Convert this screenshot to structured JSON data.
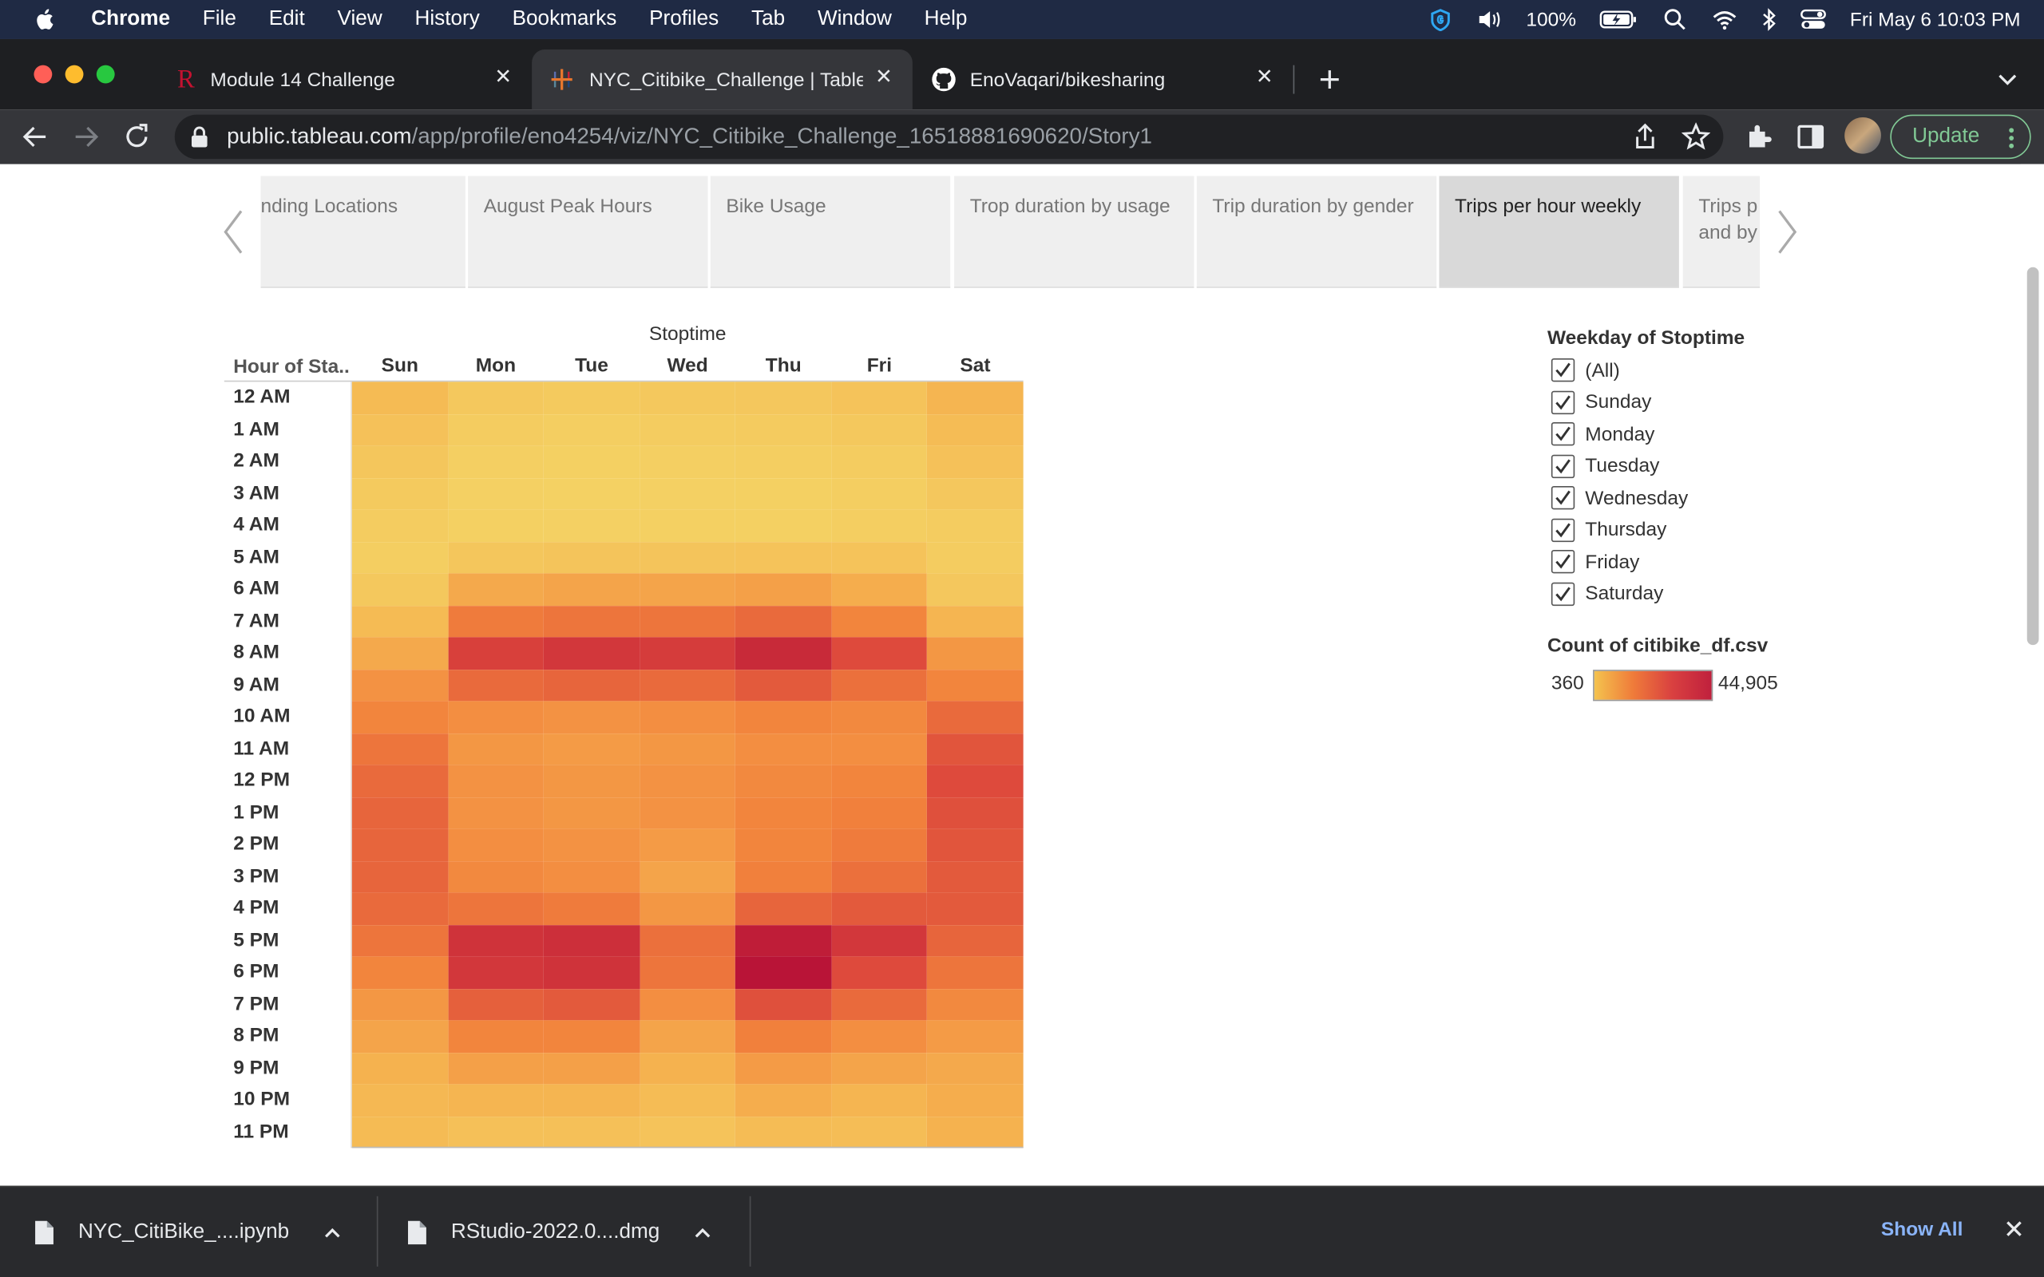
{
  "menubar": {
    "items": [
      "Chrome",
      "File",
      "Edit",
      "View",
      "History",
      "Bookmarks",
      "Profiles",
      "Tab",
      "Window",
      "Help"
    ],
    "battery": "100%",
    "clock": "Fri May 6  10:03 PM"
  },
  "tabs": [
    {
      "title": "Module 14 Challenge",
      "favicon": "r-logo-icon"
    },
    {
      "title": "NYC_Citibike_Challenge | Table",
      "favicon": "tableau-icon",
      "active": true
    },
    {
      "title": "EnoVaqari/bikesharing",
      "favicon": "github-icon"
    }
  ],
  "address": {
    "host": "public.tableau.com",
    "path": "/app/profile/eno4254/viz/NYC_Citibike_Challenge_16518881690620/Story1"
  },
  "update_label": "Update",
  "story_points": [
    {
      "label": "nding Locations"
    },
    {
      "label": "August Peak Hours"
    },
    {
      "label": "Bike Usage"
    },
    {
      "label": "Trop duration by usage"
    },
    {
      "label": "Trip duration by gender"
    },
    {
      "label": "Trips per hour weekly",
      "active": true
    },
    {
      "label": "Trips p and by"
    }
  ],
  "chart_data": {
    "type": "heatmap",
    "title": "Stoptime",
    "row_header": "Hour of Sta..",
    "columns": [
      "Sun",
      "Mon",
      "Tue",
      "Wed",
      "Thu",
      "Fri",
      "Sat"
    ],
    "rows": [
      "12 AM",
      "1 AM",
      "2 AM",
      "3 AM",
      "4 AM",
      "5 AM",
      "6 AM",
      "7 AM",
      "8 AM",
      "9 AM",
      "10 AM",
      "11 AM",
      "12 PM",
      "1 PM",
      "2 PM",
      "3 PM",
      "4 PM",
      "5 PM",
      "6 PM",
      "7 PM",
      "8 PM",
      "9 PM",
      "10 PM",
      "11 PM"
    ],
    "values": [
      [
        9000,
        4000,
        3500,
        4000,
        4500,
        6000,
        11000
      ],
      [
        6500,
        2500,
        2000,
        2500,
        3000,
        4000,
        8500
      ],
      [
        5000,
        1500,
        1200,
        1500,
        1800,
        2500,
        6500
      ],
      [
        3500,
        1000,
        800,
        1000,
        1200,
        1800,
        4500
      ],
      [
        2500,
        1200,
        1000,
        1200,
        1200,
        1800,
        2500
      ],
      [
        2000,
        5000,
        5500,
        5500,
        6000,
        6000,
        2500
      ],
      [
        4000,
        14000,
        15000,
        15000,
        16000,
        13000,
        4500
      ],
      [
        9000,
        24000,
        25000,
        25000,
        27000,
        22000,
        11000
      ],
      [
        14000,
        35000,
        37000,
        36000,
        40000,
        33000,
        18000
      ],
      [
        19000,
        27000,
        28000,
        27000,
        30000,
        26000,
        22000
      ],
      [
        22000,
        20000,
        19000,
        20000,
        22000,
        21000,
        27000
      ],
      [
        25000,
        18000,
        17000,
        18000,
        20000,
        20000,
        31000
      ],
      [
        27000,
        19000,
        18000,
        19000,
        21000,
        22000,
        33000
      ],
      [
        28000,
        19000,
        18000,
        19000,
        22000,
        23000,
        32000
      ],
      [
        28000,
        20000,
        19000,
        17000,
        22000,
        24000,
        31000
      ],
      [
        28000,
        21000,
        20000,
        15000,
        23000,
        26000,
        30000
      ],
      [
        27000,
        25000,
        24000,
        18000,
        28000,
        30000,
        30000
      ],
      [
        25000,
        38000,
        39000,
        26000,
        43000,
        37000,
        28000
      ],
      [
        22000,
        37000,
        38000,
        25000,
        44905,
        33000,
        25000
      ],
      [
        18000,
        29000,
        30000,
        20000,
        32000,
        27000,
        21000
      ],
      [
        15000,
        22000,
        22000,
        15000,
        23000,
        20000,
        17000
      ],
      [
        12000,
        16000,
        16000,
        12000,
        17000,
        15000,
        14000
      ],
      [
        10000,
        11000,
        11000,
        8500,
        13000,
        11000,
        13000
      ],
      [
        9000,
        7000,
        7000,
        6000,
        8500,
        8000,
        12000
      ]
    ]
  },
  "filter": {
    "title": "Weekday of Stoptime",
    "options": [
      "(All)",
      "Sunday",
      "Monday",
      "Tuesday",
      "Wednesday",
      "Thursday",
      "Friday",
      "Saturday"
    ]
  },
  "legend": {
    "title": "Count of citibike_df.csv",
    "min": "360",
    "max": "44,905"
  },
  "downloads": [
    {
      "name": "NYC_CitiBike_....ipynb"
    },
    {
      "name": "RStudio-2022.0....dmg"
    }
  ],
  "show_all": "Show All"
}
